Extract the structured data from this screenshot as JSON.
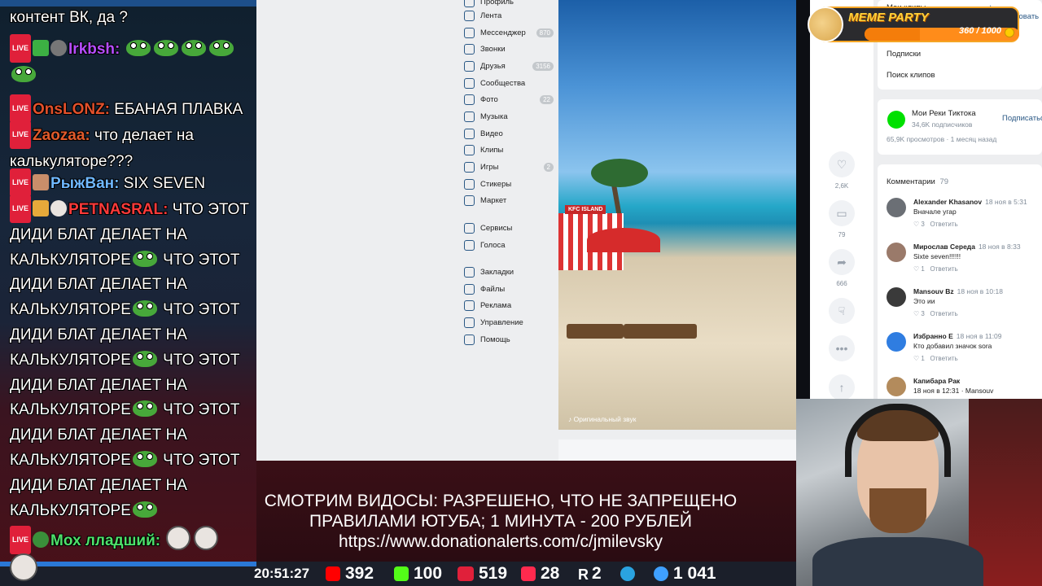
{
  "chat": {
    "messages": [
      {
        "live": "LIVE",
        "nick": "",
        "text": "контент ВК, да ?"
      },
      {
        "live": "LIVE",
        "nick": "Irkbsh:",
        "text": ""
      },
      {
        "live": "LIVE",
        "nick": "OnsLONZ:",
        "text": "ЕБАНАЯ ПЛАВКА"
      },
      {
        "live": "LIVE",
        "nick": "Zaozaa:",
        "text": "что делает на калькуляторе???"
      },
      {
        "live": "LIVE",
        "nick": "РыжВан:",
        "text": "SIX SEVEN"
      },
      {
        "live": "LIVE",
        "nick": "PETNASRAL:",
        "text": "ЧТО ЭТОТ ДИДИ БЛАТ ДЕЛАЕТ НА КАЛЬКУЛЯТОРЕ",
        "repeat": "ЧТО ЭТОТ ДИДИ БЛАТ ДЕЛАЕТ НА КАЛЬКУЛЯТОРЕ"
      },
      {
        "live": "LIVE",
        "nick": "Мох лладший:",
        "text": ""
      }
    ],
    "colors": {
      "irkbsh": "#b64dff",
      "onslonz": "#e2502b",
      "zaozaa": "#e05a2b",
      "ryzhvan": "#6fb8ff",
      "petnasral": "#ff3a3a",
      "moh": "#4ee06a"
    }
  },
  "vk": {
    "nav": [
      {
        "label": "Профиль",
        "icon": "profile-icon",
        "count": ""
      },
      {
        "label": "Лента",
        "icon": "feed-icon",
        "count": ""
      },
      {
        "label": "Мессенджер",
        "icon": "messenger-icon",
        "count": "870"
      },
      {
        "label": "Звонки",
        "icon": "phone-icon",
        "count": ""
      },
      {
        "label": "Друзья",
        "icon": "friends-icon",
        "count": "3156"
      },
      {
        "label": "Сообщества",
        "icon": "communities-icon",
        "count": ""
      },
      {
        "label": "Фото",
        "icon": "photo-icon",
        "count": "22"
      },
      {
        "label": "Музыка",
        "icon": "music-icon",
        "count": ""
      },
      {
        "label": "Видео",
        "icon": "video-icon",
        "count": ""
      },
      {
        "label": "Клипы",
        "icon": "clips-icon",
        "count": ""
      },
      {
        "label": "Игры",
        "icon": "games-icon",
        "count": "2"
      },
      {
        "label": "Стикеры",
        "icon": "stickers-icon",
        "count": ""
      },
      {
        "label": "Маркет",
        "icon": "market-icon",
        "count": ""
      },
      {
        "label": "Сервисы",
        "icon": "services-icon",
        "count": ""
      },
      {
        "label": "Голоса",
        "icon": "votes-icon",
        "count": ""
      },
      {
        "label": "Закладки",
        "icon": "bookmarks-icon",
        "count": ""
      },
      {
        "label": "Файлы",
        "icon": "files-icon",
        "count": ""
      },
      {
        "label": "Реклама",
        "icon": "ads-icon",
        "count": ""
      },
      {
        "label": "Управление",
        "icon": "manage-icon",
        "count": ""
      },
      {
        "label": "Помощь",
        "icon": "help-icon",
        "count": ""
      }
    ],
    "video": {
      "sound_label": "♪ Оригинальный звук",
      "sign": "KFC ISLAND"
    },
    "actions": [
      {
        "icon": "heart-icon",
        "count": "2,6K"
      },
      {
        "icon": "comment-icon",
        "count": "79"
      },
      {
        "icon": "share-icon",
        "count": "666"
      },
      {
        "icon": "dislike-icon",
        "count": ""
      },
      {
        "icon": "more-icon",
        "count": ""
      },
      {
        "icon": "up-arrow-icon",
        "count": ""
      }
    ],
    "side": {
      "my_clips": "Мои клипы",
      "publish": "+ Опубликовать",
      "subscriptions": "Подписки",
      "search_clips": "Поиск клипов",
      "channel_name": "Мои Реки Тиктока",
      "channel_subs": "34,6K подписчиков",
      "subscribe": "Подписаться",
      "views": "65,9K просмотров · 1 месяц назад",
      "comments_label": "Комментарии",
      "comments_count": "79",
      "comments": [
        {
          "name": "Alexander Khasanov",
          "date": "18 ноя в 5:31",
          "text": "Вначале угар",
          "likes": "♡ 3",
          "reply": "Ответить"
        },
        {
          "name": "Мирослав Середа",
          "date": "18 ноя в 8:33",
          "text": "Sixte seven!!!!!!",
          "likes": "♡ 1",
          "reply": "Ответить"
        },
        {
          "name": "Mansouv Bz",
          "date": "18 ноя в 10:18",
          "text": "Это ии",
          "likes": "♡ 3",
          "reply": "Ответить"
        },
        {
          "name": "Избранно Е",
          "date": "18 ноя в 11:09",
          "text": "Кто добавил значок sora",
          "likes": "♡ 1",
          "reply": "Ответить"
        },
        {
          "name": "Капибара Рак",
          "date": "",
          "text": "18 ноя в 12:31 · Mansouv",
          "likes": "",
          "reply": ""
        }
      ]
    }
  },
  "meme": {
    "title": "MEME PARTY",
    "score": "360 / 1000",
    "progress": 0.36
  },
  "banner": {
    "line1": "СМОТРИМ ВИДОСЫ: РАЗРЕШЕНО, ЧТО НЕ ЗАПРЕЩЕНО",
    "line2": "ПРАВИЛАМИ ЮТУБА; 1 МИНУТА - 200 РУБЛЕЙ",
    "line3": "https://www.donationalerts.com/c/jmilevsky"
  },
  "stats": {
    "time": "20:51:27",
    "youtube": "392",
    "kick": "100",
    "live": "519",
    "vkplay": "28",
    "rutube": "2",
    "telegram": "",
    "viewers": "1 041"
  }
}
